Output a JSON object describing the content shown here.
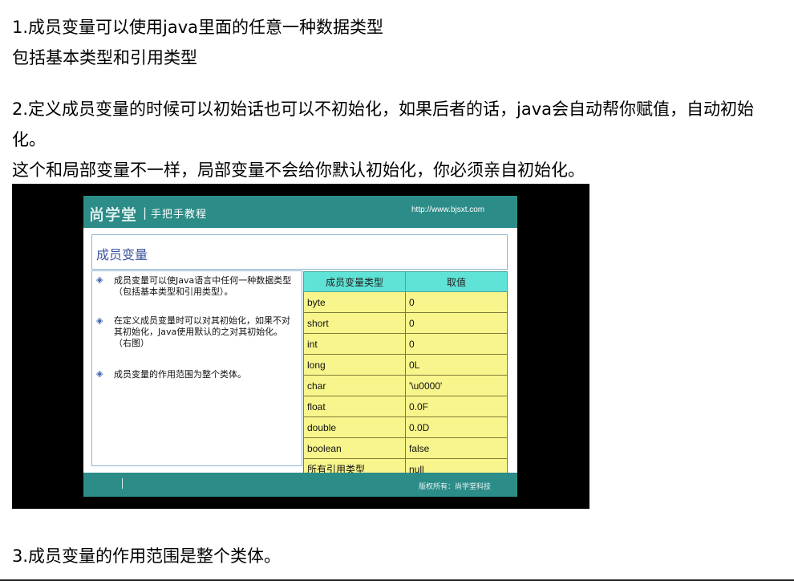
{
  "article": {
    "p1_line1": "1.成员变量可以使用java里面的任意一种数据类型",
    "p1_line2": "包括基本类型和引用类型",
    "p2_line1": "2.定义成员变量的时候可以初始话也可以不初始化，如果后者的话，java会自动帮你赋值，自动初始",
    "p2_line2": "化。",
    "p2_line3": "这个和局部变量不一样，局部变量不会给你默认初始化，你必须亲自初始化。",
    "p3": "3.成员变量的作用范围是整个类体。"
  },
  "slide": {
    "logo": "尚学堂",
    "separator": "|",
    "tagline": "手把手教程",
    "url": "http://www.bjsxt.com",
    "title": "成员变量",
    "bullet_icon": "diamond-bullet-icon",
    "bullet_symbol": "◈",
    "bullets": [
      "成员变量可以使Java语言中任何一种数据类型（包括基本类型和引用类型）。",
      "在定义成员变量时可以对其初始化，如果不对其初始化，Java使用默认的之对其初始化。（右图）",
      "成员变量的作用范围为整个类体。"
    ],
    "table_headers": [
      "成员变量类型",
      "取值"
    ],
    "table_rows": [
      [
        "byte",
        "0"
      ],
      [
        "short",
        "0"
      ],
      [
        "int",
        "0"
      ],
      [
        "long",
        "0L"
      ],
      [
        "char",
        "'\\u0000'"
      ],
      [
        "float",
        "0.0F"
      ],
      [
        "double",
        "0.0D"
      ],
      [
        "boolean",
        "false"
      ],
      [
        "所有引用类型",
        "null"
      ]
    ],
    "copyright": "版权所有：尚学堂科技",
    "colors": {
      "header": "#2c8c88",
      "table_header": "#5fe3d6",
      "table_cell": "#f7f58c",
      "title": "#3a55a0"
    }
  }
}
